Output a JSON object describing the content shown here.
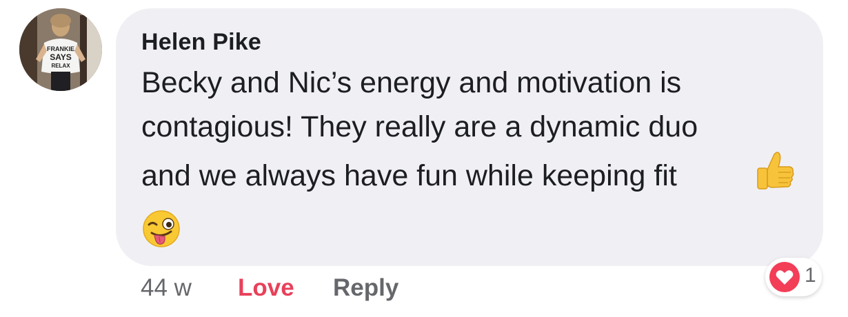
{
  "comment": {
    "author": "Helen Pike",
    "lines": [
      "Becky and Nic’s energy and motivation is",
      "contagious! They really are a dynamic duo",
      "and we always have fun while keeping fit"
    ],
    "emojis": [
      "thumbs-up",
      "winking-face-with-tongue"
    ],
    "avatar_shirt_text": [
      "FRANKIE",
      "SAYS",
      "RELAX"
    ]
  },
  "actions": {
    "timestamp": "44 w",
    "love_label": "Love",
    "reply_label": "Reply"
  },
  "reactions": {
    "type": "heart",
    "count": "1"
  },
  "colors": {
    "bubble": "#f0f0f4",
    "text": "#1c1e21",
    "muted": "#65676b",
    "love": "#e8415a",
    "heart": "#f33e58"
  }
}
